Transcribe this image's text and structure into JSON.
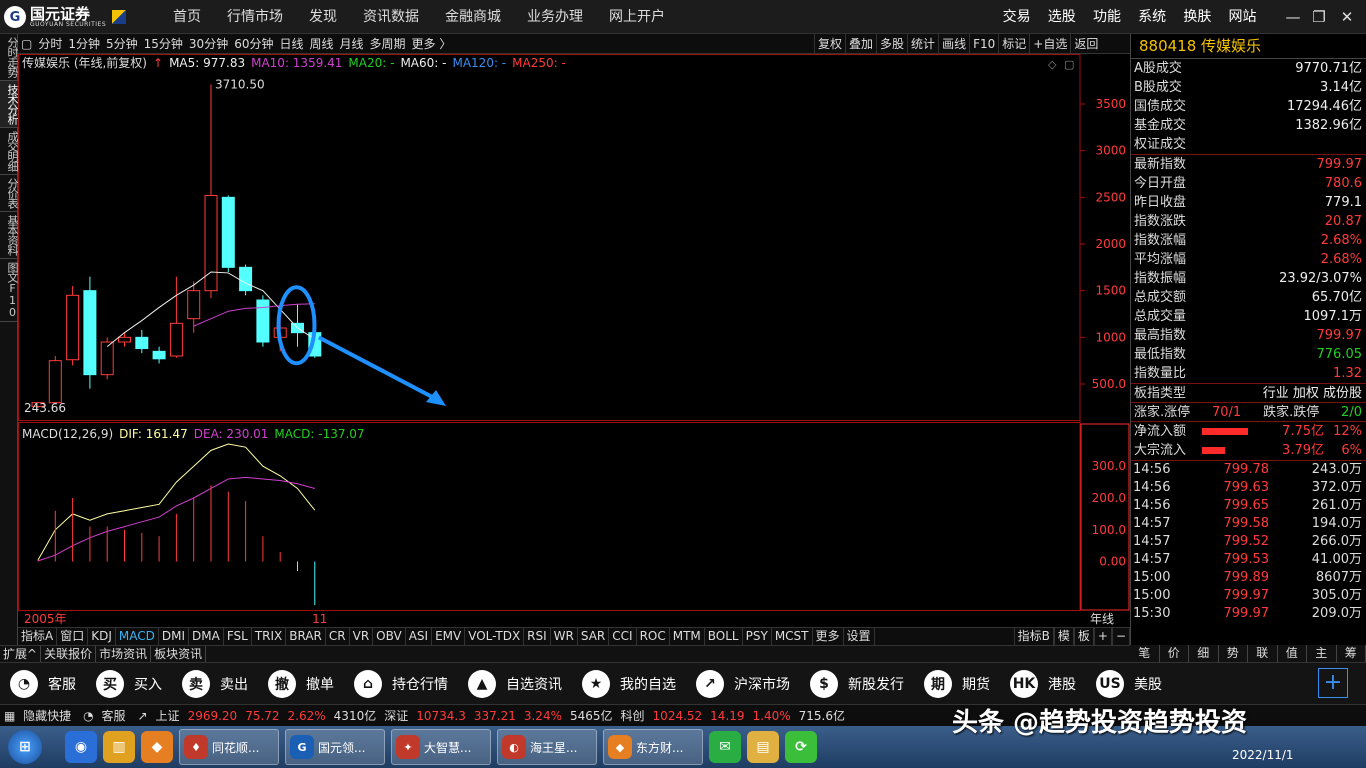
{
  "logo": {
    "mark": "G",
    "name": "国元证券",
    "en": "GUOYUAN SECURITIES"
  },
  "main_nav": [
    "首页",
    "行情市场",
    "发现",
    "资讯数据",
    "金融商城",
    "业务办理",
    "网上开户"
  ],
  "right_nav": [
    "交易",
    "选股",
    "功能",
    "系统",
    "换肤",
    "网站"
  ],
  "window_controls": [
    "—",
    "❐",
    "✕"
  ],
  "left_tabs": [
    "分时走势",
    "技术分析",
    "成交明细",
    "分价表",
    "基本资料",
    "图文F10"
  ],
  "left_tab_active": 1,
  "period_bar": [
    "分时",
    "1分钟",
    "5分钟",
    "15分钟",
    "30分钟",
    "60分钟",
    "日线",
    "周线",
    "月线",
    "多周期",
    "更多 〉"
  ],
  "chart_toolbar": [
    "复权",
    "叠加",
    "多股",
    "统计",
    "画线",
    "F10",
    "标记",
    "+自选",
    "返回"
  ],
  "chart": {
    "stock_title": "传媒娱乐 (年线,前复权)",
    "ma_legend": [
      {
        "label": "MA5: 977.83",
        "color": "#eeeeee"
      },
      {
        "label": "MA10: 1359.41",
        "color": "#d040d0"
      },
      {
        "label": "MA20: -",
        "color": "#20d020"
      },
      {
        "label": "MA60: -",
        "color": "#eeeeee"
      },
      {
        "label": "MA120: -",
        "color": "#3a8ef0"
      },
      {
        "label": "MA250: -",
        "color": "#ff3b3b"
      }
    ],
    "high_label": "3710.50",
    "low_label": "243.66",
    "price_axis": [
      "3500",
      "3000",
      "2500",
      "2000",
      "1500",
      "1000",
      "500.0"
    ],
    "macd_legend": {
      "name": "MACD(12,26,9)",
      "dif": "DIF: 161.47",
      "dea": "DEA: 230.01",
      "macd": "MACD: -137.07"
    },
    "macd_axis": [
      "300.0",
      "200.0",
      "100.0",
      "0.00"
    ],
    "x_start": "2005年",
    "x_mid": "11",
    "period_label": "年线"
  },
  "chart_data": {
    "type": "candlestick",
    "candles": [
      {
        "o": 260,
        "h": 310,
        "l": 243.66,
        "c": 300
      },
      {
        "o": 300,
        "h": 800,
        "l": 280,
        "c": 750
      },
      {
        "o": 760,
        "h": 1550,
        "l": 700,
        "c": 1450
      },
      {
        "o": 1500,
        "h": 1650,
        "l": 450,
        "c": 600
      },
      {
        "o": 600,
        "h": 1000,
        "l": 550,
        "c": 950
      },
      {
        "o": 950,
        "h": 1050,
        "l": 900,
        "c": 1000
      },
      {
        "o": 1000,
        "h": 1080,
        "l": 830,
        "c": 880
      },
      {
        "o": 850,
        "h": 900,
        "l": 720,
        "c": 770
      },
      {
        "o": 800,
        "h": 1650,
        "l": 780,
        "c": 1150
      },
      {
        "o": 1200,
        "h": 1600,
        "l": 1050,
        "c": 1500
      },
      {
        "o": 1500,
        "h": 3710.5,
        "l": 1420,
        "c": 2520
      },
      {
        "o": 2500,
        "h": 2520,
        "l": 1700,
        "c": 1750
      },
      {
        "o": 1750,
        "h": 1780,
        "l": 1450,
        "c": 1500
      },
      {
        "o": 1400,
        "h": 1450,
        "l": 900,
        "c": 950
      },
      {
        "o": 1000,
        "h": 1350,
        "l": 850,
        "c": 1100
      },
      {
        "o": 1150,
        "h": 1350,
        "l": 900,
        "c": 1050
      },
      {
        "o": 1050,
        "h": 1100,
        "l": 780,
        "c": 800
      }
    ],
    "ma5": [
      null,
      null,
      null,
      null,
      900,
      1050,
      1180,
      1320,
      1450,
      1560,
      1700,
      1690,
      1580,
      1500,
      1300,
      1100,
      980
    ],
    "ma10": [
      null,
      null,
      null,
      null,
      null,
      null,
      null,
      null,
      null,
      1120,
      1200,
      1280,
      1310,
      1320,
      1340,
      1355,
      1359.41
    ],
    "dif": [
      5,
      100,
      150,
      130,
      150,
      160,
      170,
      180,
      250,
      300,
      350,
      370,
      360,
      300,
      270,
      230,
      161.47
    ],
    "dea": [
      2,
      20,
      50,
      75,
      95,
      110,
      125,
      140,
      175,
      200,
      230,
      260,
      265,
      260,
      255,
      245,
      230.01
    ],
    "macd_bar": [
      6,
      160,
      200,
      110,
      110,
      100,
      90,
      80,
      150,
      200,
      240,
      220,
      190,
      80,
      30,
      -30,
      -137.07
    ],
    "ylim_price": [
      200,
      3800
    ],
    "ylim_macd": [
      -140,
      370
    ]
  },
  "bottom_indicators": [
    "指标A",
    "窗口",
    "KDJ",
    "MACD",
    "DMI",
    "DMA",
    "FSL",
    "TRIX",
    "BRAR",
    "CR",
    "VR",
    "OBV",
    "ASI",
    "EMV",
    "VOL-TDX",
    "RSI",
    "WR",
    "SAR",
    "CCI",
    "ROC",
    "MTM",
    "BOLL",
    "PSY",
    "MCST",
    "更多",
    "设置"
  ],
  "bottom_active": "MACD",
  "bottom_right": [
    "指标B",
    "模",
    "板",
    "+",
    "−"
  ],
  "bottom2": [
    "扩展^",
    "关联报价",
    "市场资讯",
    "板块资讯"
  ],
  "right_panel": {
    "header": "880418 传媒娱乐",
    "vol_rows": [
      {
        "k": "A股成交",
        "v": "9770.71亿"
      },
      {
        "k": "B股成交",
        "v": "3.14亿"
      },
      {
        "k": "国债成交",
        "v": "17294.46亿"
      },
      {
        "k": "基金成交",
        "v": "1382.96亿"
      },
      {
        "k": "权证成交",
        "v": ""
      }
    ],
    "stat_rows": [
      {
        "k": "最新指数",
        "v": "799.97",
        "c": "red"
      },
      {
        "k": "今日开盘",
        "v": "780.6",
        "c": "red"
      },
      {
        "k": "昨日收盘",
        "v": "779.1",
        "c": "white"
      },
      {
        "k": "指数涨跌",
        "v": "20.87",
        "c": "red"
      },
      {
        "k": "指数涨幅",
        "v": "2.68%",
        "c": "red"
      },
      {
        "k": "平均涨幅",
        "v": "2.68%",
        "c": "red"
      },
      {
        "k": "指数振幅",
        "v": "23.92/3.07%",
        "c": "white"
      },
      {
        "k": "总成交额",
        "v": "65.70亿",
        "c": "white"
      },
      {
        "k": "总成交量",
        "v": "1097.1万",
        "c": "white"
      },
      {
        "k": "最高指数",
        "v": "799.97",
        "c": "red"
      },
      {
        "k": "最低指数",
        "v": "776.05",
        "c": "green"
      },
      {
        "k": "指数量比",
        "v": "1.32",
        "c": "red"
      }
    ],
    "board_type_label": "板指类型",
    "board_type_value": "行业 加权 成份股",
    "limit": {
      "k1": "涨家.涨停",
      "v1": "70/1",
      "k2": "跌家.跌停",
      "v2": "2/0"
    },
    "flow_rows": [
      {
        "k": "净流入额",
        "v": "7.75亿",
        "p": "12%",
        "bar": 0.7
      },
      {
        "k": "大宗流入",
        "v": "3.79亿",
        "p": "6%",
        "bar": 0.35
      }
    ],
    "ticks": [
      {
        "t": "14:56",
        "p": "799.78",
        "v": "243.0万"
      },
      {
        "t": "14:56",
        "p": "799.63",
        "v": "372.0万"
      },
      {
        "t": "14:56",
        "p": "799.65",
        "v": "261.0万"
      },
      {
        "t": "14:57",
        "p": "799.58",
        "v": "194.0万"
      },
      {
        "t": "14:57",
        "p": "799.52",
        "v": "266.0万"
      },
      {
        "t": "14:57",
        "p": "799.53",
        "v": "41.00万"
      },
      {
        "t": "15:00",
        "p": "799.89",
        "v": "8607万"
      },
      {
        "t": "15:00",
        "p": "799.97",
        "v": "305.0万"
      },
      {
        "t": "15:30",
        "p": "799.97",
        "v": "209.0万"
      }
    ],
    "tabs": [
      "笔",
      "价",
      "细",
      "势",
      "联",
      "值",
      "主",
      "筹"
    ]
  },
  "quickbar": [
    {
      "icon": "◔",
      "label": "客服",
      "name": "customer-service"
    },
    {
      "icon": "买",
      "label": "买入",
      "name": "buy"
    },
    {
      "icon": "卖",
      "label": "卖出",
      "name": "sell"
    },
    {
      "icon": "撤",
      "label": "撤单",
      "name": "cancel-order"
    },
    {
      "icon": "⌂",
      "label": "持仓行情",
      "name": "positions"
    },
    {
      "icon": "▲",
      "label": "自选资讯",
      "name": "watchlist-news"
    },
    {
      "icon": "★",
      "label": "我的自选",
      "name": "my-watchlist"
    },
    {
      "icon": "↗",
      "label": "沪深市场",
      "name": "market"
    },
    {
      "icon": "$",
      "label": "新股发行",
      "name": "ipo"
    },
    {
      "icon": "期",
      "label": "期货",
      "name": "futures"
    },
    {
      "icon": "HK",
      "label": "港股",
      "name": "hk-stocks"
    },
    {
      "icon": "US",
      "label": "美股",
      "name": "us-stocks"
    }
  ],
  "quickbar_plus": "+",
  "statusbar": {
    "hide": "隐藏快捷",
    "service": "客服",
    "sh_label": "上证",
    "sh_val": "2969.20",
    "sh_chg": "75.72",
    "sh_pct": "2.62%",
    "sh_vol": "4310亿",
    "sz_label": "深证",
    "sz_val": "10734.3",
    "sz_chg": "337.21",
    "sz_pct": "3.24%",
    "sz_vol": "5465亿",
    "kc_label": "科创",
    "kc_val": "1024.52",
    "kc_chg": "14.19",
    "kc_pct": "1.40%",
    "kc_vol": "715.6亿"
  },
  "taskbar": [
    {
      "label": "同花顺...",
      "color": "#c0392b",
      "icon": "♦"
    },
    {
      "label": "国元领...",
      "color": "#1a5fb4",
      "icon": "G"
    },
    {
      "label": "大智慧...",
      "color": "#c0392b",
      "icon": "✦"
    },
    {
      "label": "海王星...",
      "color": "#c0392b",
      "icon": "◐"
    },
    {
      "label": "东方财...",
      "color": "#e67e22",
      "icon": "◆"
    }
  ],
  "watermark": "头条 @趋势投资趋势投资",
  "clock": "2022/11/1"
}
